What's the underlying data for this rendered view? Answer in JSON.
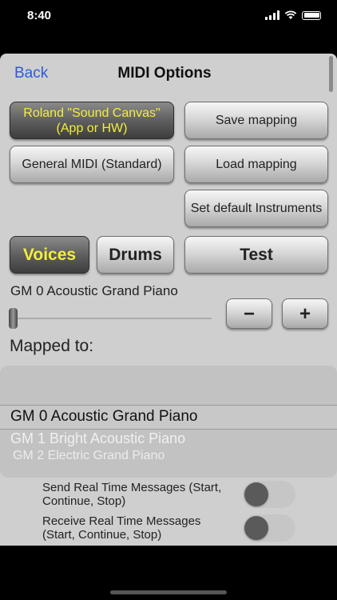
{
  "status_bar": {
    "time": "8:40"
  },
  "nav": {
    "back_label": "Back",
    "title": "MIDI Options"
  },
  "buttons": {
    "roland": "Roland \"Sound Canvas\" (App or HW)",
    "general_midi": "General MIDI (Standard)",
    "save_mapping": "Save mapping",
    "load_mapping": "Load mapping",
    "set_default": "Set default Instruments",
    "voices": "Voices",
    "drums": "Drums",
    "test": "Test",
    "minus": "−",
    "plus": "+"
  },
  "current_instrument": "GM 0  Acoustic Grand Piano",
  "slider_value": 0,
  "mapped_to_label": "Mapped to:",
  "picker": {
    "selected": "GM 0  Acoustic Grand Piano",
    "next1": "GM 1  Bright Acoustic Piano",
    "next2": "GM 2  Electric Grand Piano"
  },
  "realtime": {
    "send_label": "Send Real Time Messages (Start, Continue, Stop)",
    "receive_label": "Receive Real Time Messages (Start, Continue, Stop)",
    "send_on": false,
    "receive_on": false
  },
  "colors": {
    "accent_blue": "#2c5bdc",
    "highlight_yellow": "#f3ee3a",
    "panel_gray": "#cfcfcf"
  }
}
